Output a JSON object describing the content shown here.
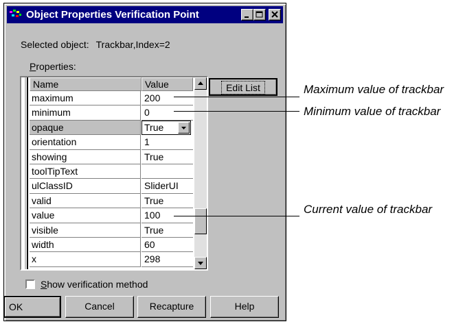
{
  "window": {
    "title": "Object Properties Verification Point",
    "selected_label": "Selected object:",
    "selected_value": "Trackbar,Index=2",
    "properties_label_first": "P",
    "properties_label_rest": "roperties:"
  },
  "grid": {
    "columns": [
      "Name",
      "Value"
    ],
    "rows": [
      {
        "name": "maximum",
        "value": "200"
      },
      {
        "name": "minimum",
        "value": "0"
      },
      {
        "name": "opaque",
        "value": "True"
      },
      {
        "name": "orientation",
        "value": "1"
      },
      {
        "name": "showing",
        "value": "True"
      },
      {
        "name": "toolTipText",
        "value": ""
      },
      {
        "name": "ulClassID",
        "value": "SliderUI"
      },
      {
        "name": "valid",
        "value": "True"
      },
      {
        "name": "value",
        "value": "100"
      },
      {
        "name": "visible",
        "value": "True"
      },
      {
        "name": "width",
        "value": "60"
      },
      {
        "name": "x",
        "value": "298"
      }
    ]
  },
  "buttons": {
    "edit_list": "Edit List",
    "ok": "OK",
    "cancel": "Cancel",
    "recapture": "Recapture",
    "help": "Help"
  },
  "checkbox": {
    "label_first": "S",
    "label_rest": "how verification method",
    "checked": false
  },
  "annotations": {
    "maximum": "Maximum value of trackbar",
    "minimum": "Minimum value of trackbar",
    "current": "Current value of trackbar"
  },
  "colors": {
    "titlebar": "#000080",
    "face": "#c0c0c0"
  }
}
